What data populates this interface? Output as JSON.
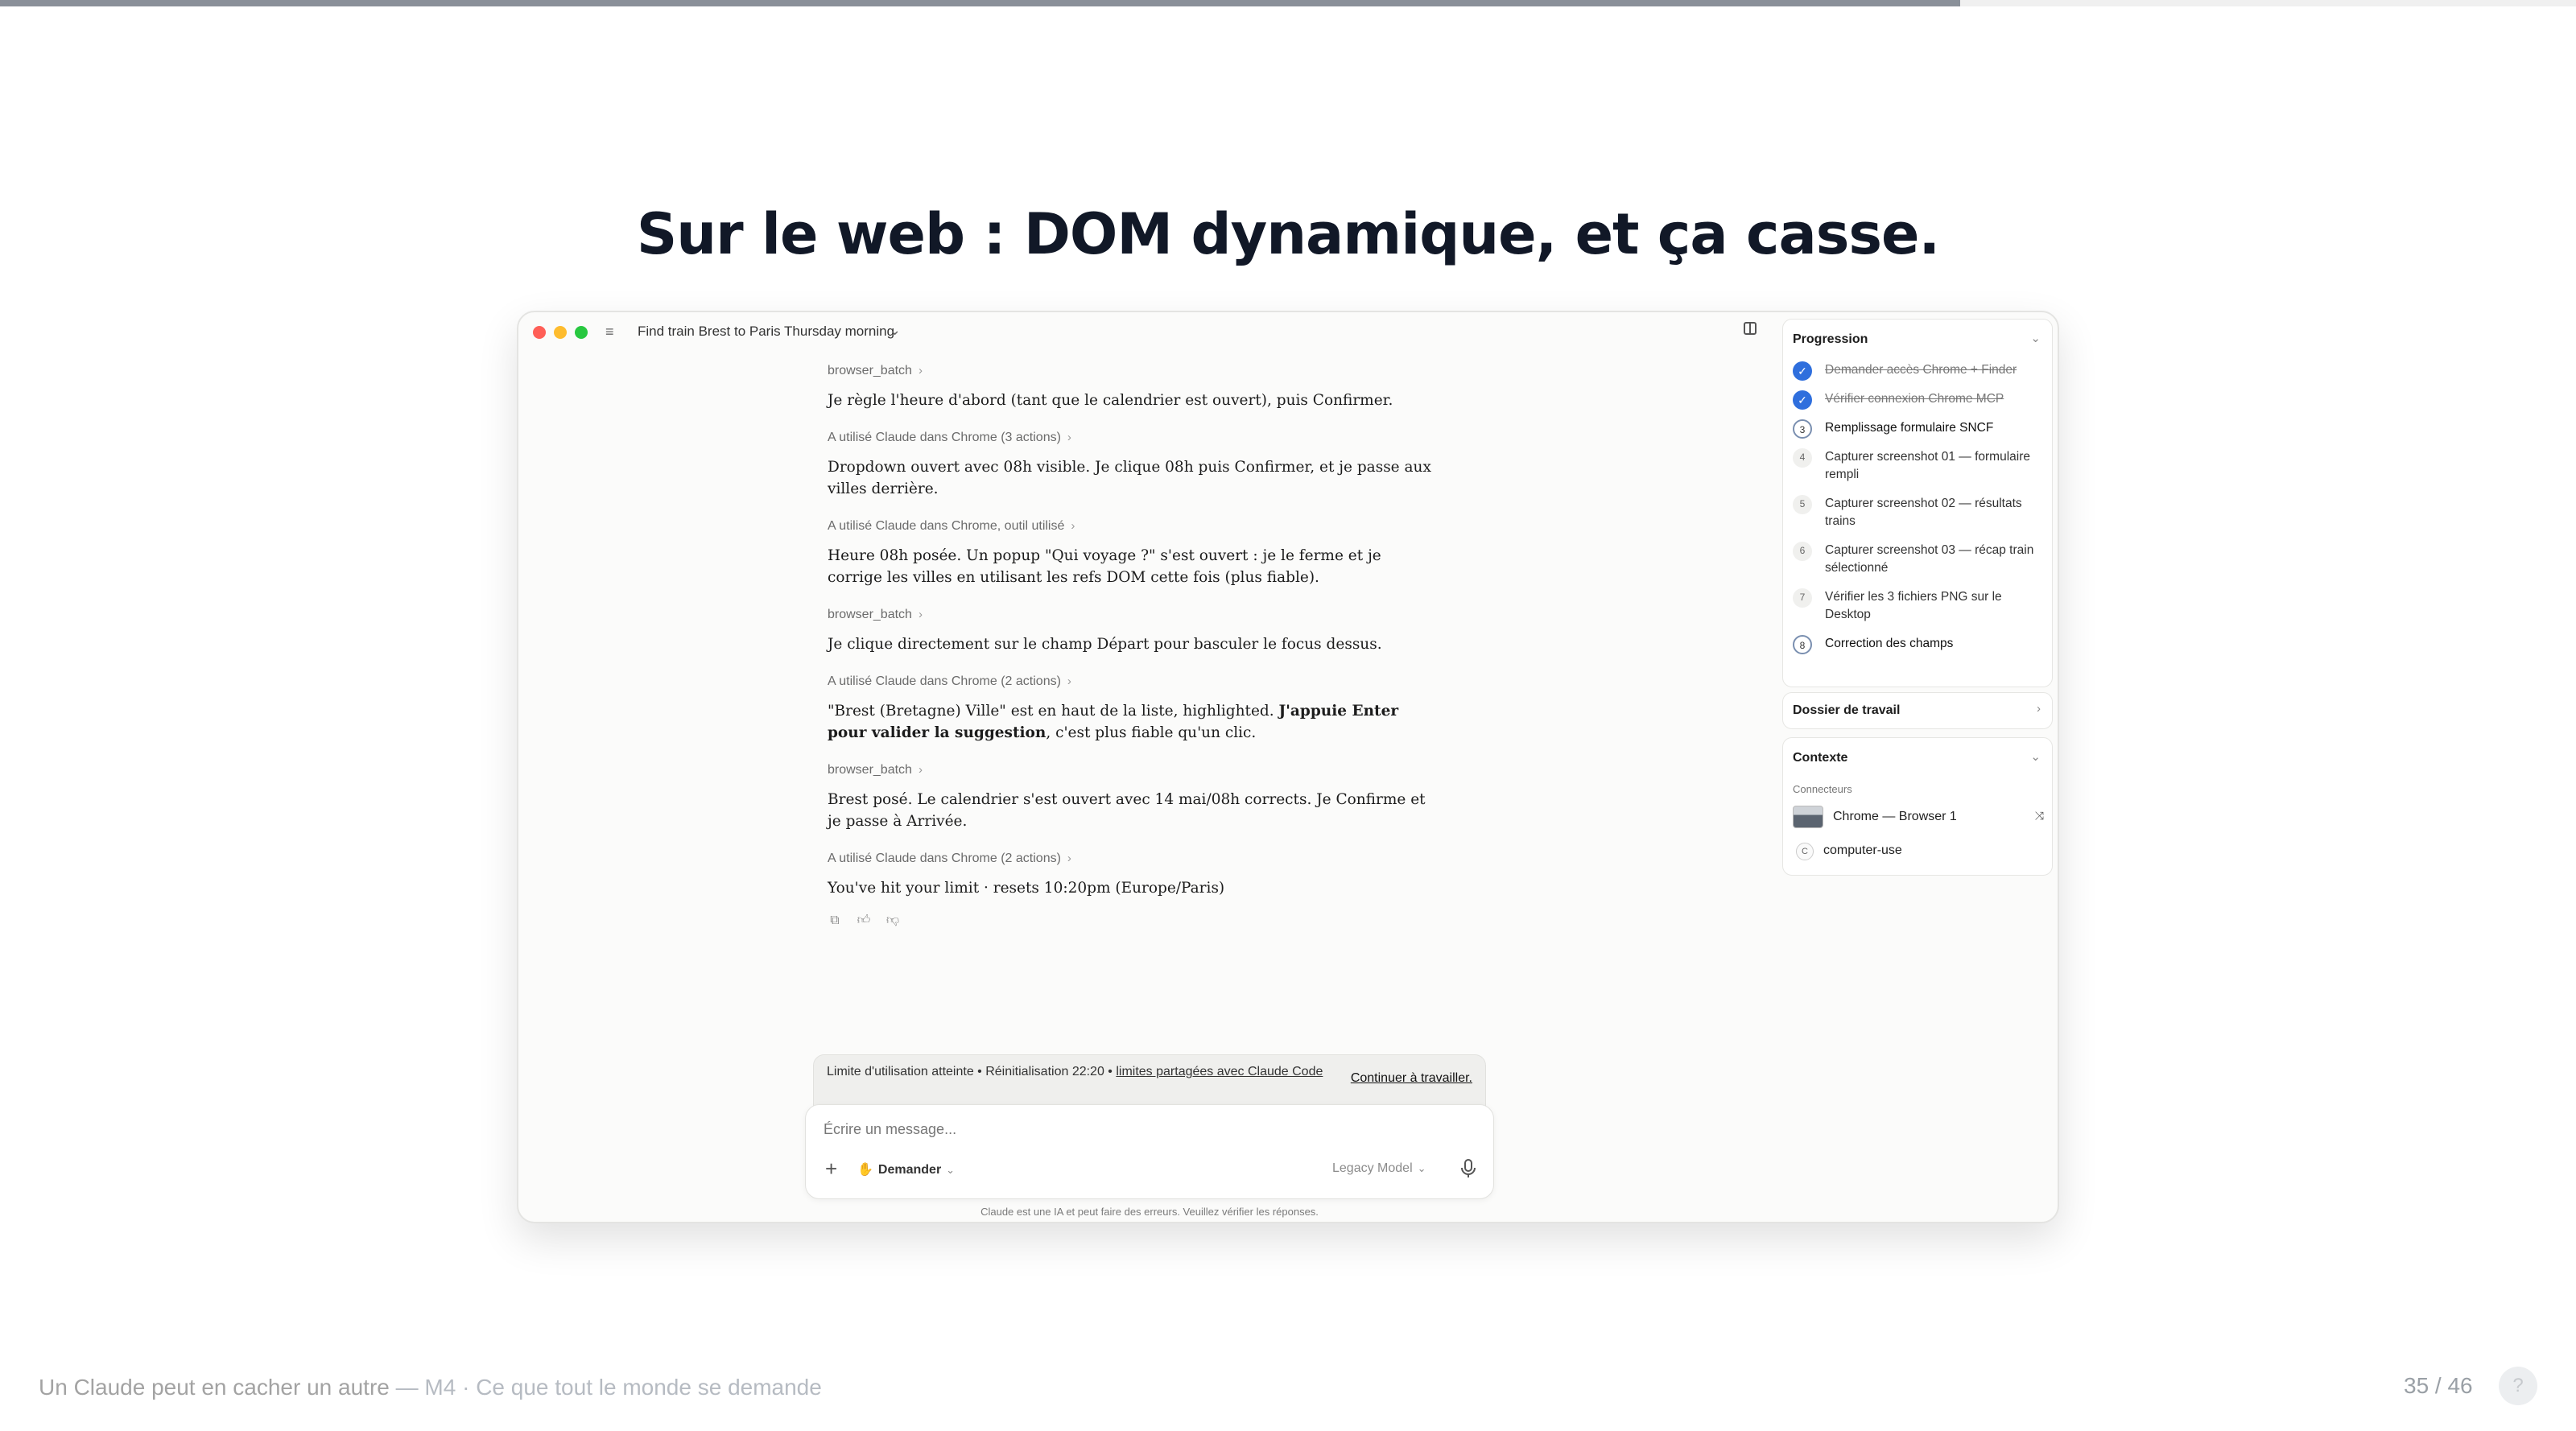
{
  "deck": {
    "progress": 0.761,
    "title": "Sur le web : DOM dynamique, et ça casse.",
    "footer_title": "Un Claude peut en cacher un autre",
    "footer_subtitle": "— M4 · Ce que tout le monde se demande",
    "page_counter": "35 / 46",
    "help_label": "?"
  },
  "window": {
    "conversation_title": "Find train Brest to Paris Thursday morning",
    "messages": [
      {
        "label": "browser_batch",
        "text_html": "Je règle l'heure d'abord (tant que le calendrier est ouvert), puis Confirmer."
      },
      {
        "label": "A utilisé Claude dans Chrome (3 actions)",
        "text_html": "Dropdown ouvert avec 08h visible. Je clique 08h puis Confirmer, et je passe aux villes derrière."
      },
      {
        "label": "A utilisé Claude dans Chrome, outil utilisé",
        "text_html": "Heure 08h posée. Un popup \"Qui voyage ?\" s'est ouvert : je le ferme et je corrige les villes en utilisant les refs DOM cette fois (plus fiable)."
      },
      {
        "label": "browser_batch",
        "text_html": "Je clique directement sur le champ Départ pour basculer le focus dessus."
      },
      {
        "label": "A utilisé Claude dans Chrome (2 actions)",
        "text_pre": "\"Brest (Bretagne) Ville\" est en haut de la liste, highlighted. ",
        "text_bold": "J'appuie Enter pour valider la suggestion",
        "text_post": ", c'est plus fiable qu'un clic."
      },
      {
        "label": "browser_batch",
        "text_html": "Brest posé. Le calendrier s'est ouvert avec 14 mai/08h corrects. Je Confirme et je passe à Arrivée."
      },
      {
        "label": "A utilisé Claude dans Chrome (2 actions)",
        "text_html": "You've hit your limit · resets 10:20pm (Europe/Paris)"
      }
    ],
    "limit_banner": {
      "text_pre": "Limite d'utilisation atteinte • Réinitialisation 22:20 • ",
      "text_link": "limites partagées avec Claude Code",
      "action": "Continuer à travailler."
    },
    "composer": {
      "placeholder": "Écrire un message...",
      "mode_label": "Demander",
      "model_label": "Legacy Model",
      "disclaimer": "Claude est une IA et peut faire des erreurs. Veuillez vérifier les réponses."
    },
    "progression": {
      "title": "Progression",
      "steps": [
        {
          "marker": "✓",
          "label": "Demander accès Chrome + Finder",
          "state": "done"
        },
        {
          "marker": "✓",
          "label": "Vérifier connexion Chrome MCP",
          "state": "done"
        },
        {
          "marker": "3",
          "label": "Remplissage formulaire SNCF",
          "state": "active"
        },
        {
          "marker": "4",
          "label": "Capturer screenshot 01 — formulaire rempli",
          "state": "pending"
        },
        {
          "marker": "5",
          "label": "Capturer screenshot 02 — résultats trains",
          "state": "pending"
        },
        {
          "marker": "6",
          "label": "Capturer screenshot 03 — récap train sélectionné",
          "state": "pending"
        },
        {
          "marker": "7",
          "label": "Vérifier les 3 fichiers PNG sur le Desktop",
          "state": "pending"
        },
        {
          "marker": "8",
          "label": "Correction des champs",
          "state": "active"
        }
      ]
    },
    "folder": {
      "title": "Dossier de travail"
    },
    "context": {
      "title": "Contexte",
      "subtitle": "Connecteurs",
      "connectors": [
        {
          "label": "Chrome — Browser 1",
          "icon": "shuffle-icon"
        },
        {
          "badge": "C",
          "label": "computer-use"
        }
      ]
    }
  }
}
